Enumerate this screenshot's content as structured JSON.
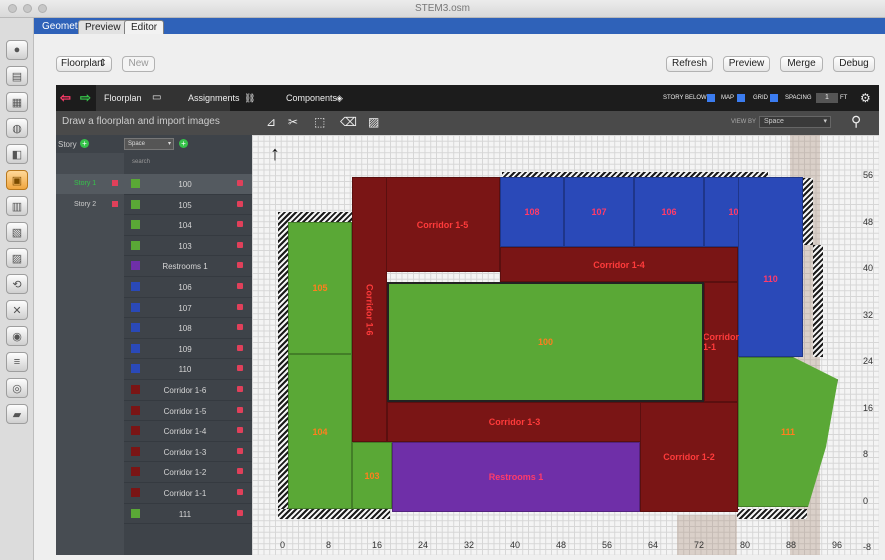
{
  "window": {
    "title": "STEM3.osm"
  },
  "tabs": [
    {
      "label": "Geometry"
    },
    {
      "label": "Preview"
    },
    {
      "label": "Editor"
    }
  ],
  "top": {
    "floorplan_select": "Floorplan",
    "new_label": "New",
    "refresh_label": "Refresh",
    "preview_label": "Preview",
    "merge_label": "Merge",
    "debug_label": "Debug"
  },
  "nav": {
    "floorplan": "Floorplan",
    "assignments": "Assignments",
    "components": "Components",
    "story_below": "STORY BELOW",
    "map": "MAP",
    "grid": "GRID",
    "spacing": "SPACING",
    "spacing_value": "1",
    "spacing_unit": "FT"
  },
  "toolbar": {
    "hint": "Draw a floorplan and import images",
    "view_by_label": "VIEW BY",
    "view_by_value": "Space"
  },
  "sidebar": {
    "story_header": "Story",
    "space_select": "Space",
    "search_placeholder": "search",
    "stories": [
      {
        "name": "Story 1"
      },
      {
        "name": "Story 2"
      }
    ],
    "spaces": [
      {
        "name": "100",
        "color": "#5aa836"
      },
      {
        "name": "105",
        "color": "#5aa836"
      },
      {
        "name": "104",
        "color": "#5aa836"
      },
      {
        "name": "103",
        "color": "#5aa836"
      },
      {
        "name": "Restrooms 1",
        "color": "#6f2fa8"
      },
      {
        "name": "106",
        "color": "#2a49b8"
      },
      {
        "name": "107",
        "color": "#2a49b8"
      },
      {
        "name": "108",
        "color": "#2a49b8"
      },
      {
        "name": "109",
        "color": "#2a49b8"
      },
      {
        "name": "110",
        "color": "#2a49b8"
      },
      {
        "name": "Corridor 1-6",
        "color": "#7a1515"
      },
      {
        "name": "Corridor 1-5",
        "color": "#7a1515"
      },
      {
        "name": "Corridor 1-4",
        "color": "#7a1515"
      },
      {
        "name": "Corridor 1-3",
        "color": "#7a1515"
      },
      {
        "name": "Corridor 1-2",
        "color": "#7a1515"
      },
      {
        "name": "Corridor 1-1",
        "color": "#7a1515"
      },
      {
        "name": "111",
        "color": "#5aa836"
      }
    ]
  },
  "plan": {
    "labels": {
      "c15": "Corridor 1-5",
      "c14": "Corridor 1-4",
      "c16": "Corridor 1-6",
      "c13": "Corridor 1-3",
      "c12": "Corridor 1-2",
      "c11": "Corridor 1-1",
      "s100": "100",
      "s105": "105",
      "s104": "104",
      "s103": "103",
      "s111": "111",
      "s106": "106",
      "s107": "107",
      "s108": "108",
      "s109": "109",
      "s110": "110",
      "restrooms": "Restrooms 1"
    },
    "x_ticks": [
      "0",
      "8",
      "16",
      "24",
      "32",
      "40",
      "48",
      "56",
      "64",
      "72",
      "80",
      "88",
      "96"
    ],
    "y_ticks": [
      "56",
      "48",
      "40",
      "32",
      "24",
      "16",
      "8",
      "0",
      "-8"
    ]
  }
}
